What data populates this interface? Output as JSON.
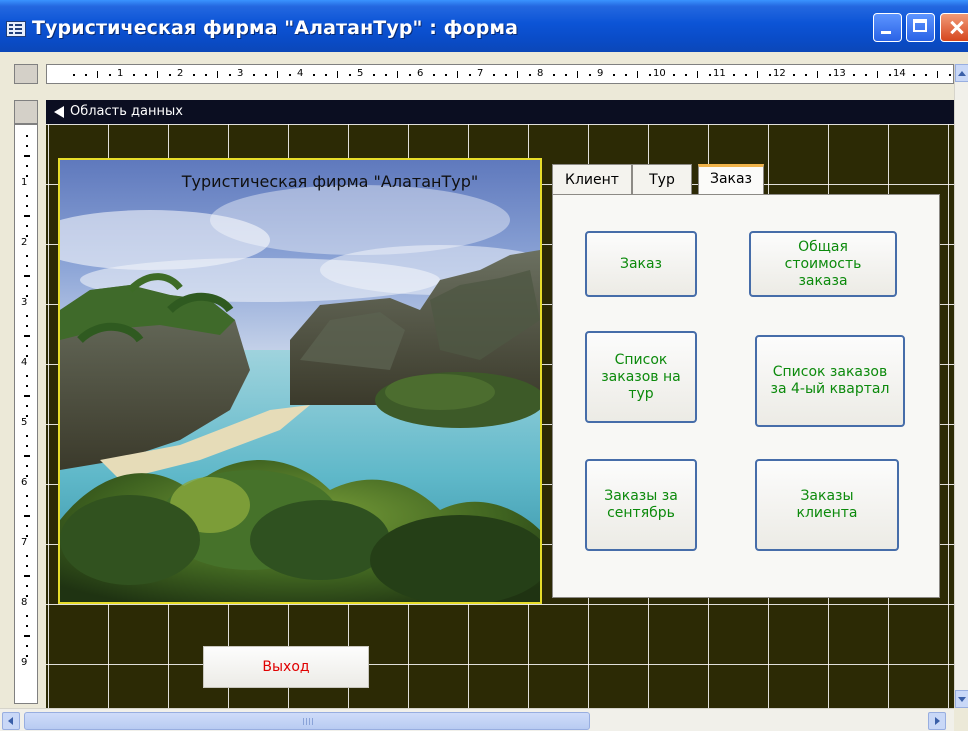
{
  "window": {
    "title": "Туристическая фирма \"АлатанТур\" : форма"
  },
  "ruler": {
    "horizontal_numbers": [
      "1",
      "2",
      "3",
      "4",
      "5",
      "6",
      "7",
      "8",
      "9",
      "10",
      "11",
      "12",
      "13",
      "14",
      "1"
    ],
    "vertical_numbers": [
      "1",
      "2",
      "3",
      "4",
      "5",
      "6",
      "7",
      "8",
      "9"
    ]
  },
  "section": {
    "label": "Область данных"
  },
  "photo": {
    "caption": "Туристическая фирма \"АлатанТур\""
  },
  "tabs": [
    {
      "label": "Клиент",
      "active": false
    },
    {
      "label": "Тур",
      "active": false
    },
    {
      "label": "Заказ",
      "active": true
    }
  ],
  "buttons": {
    "order": "Заказ",
    "total_cost": "Общая\nстоимость\nзаказа",
    "orders_for_tour": "Список\nзаказов на\nтур",
    "orders_q4": "Список заказов\nза 4-ый квартал",
    "orders_september": "Заказы за\nсентябрь",
    "client_orders": "Заказы\nклиента"
  },
  "exit_button": {
    "label": "Выход"
  },
  "colors": {
    "button_text": "#0c8a0c",
    "exit_text": "#e00000",
    "title_bar": "#0c54d6",
    "grid_bg": "#2c2a05"
  }
}
